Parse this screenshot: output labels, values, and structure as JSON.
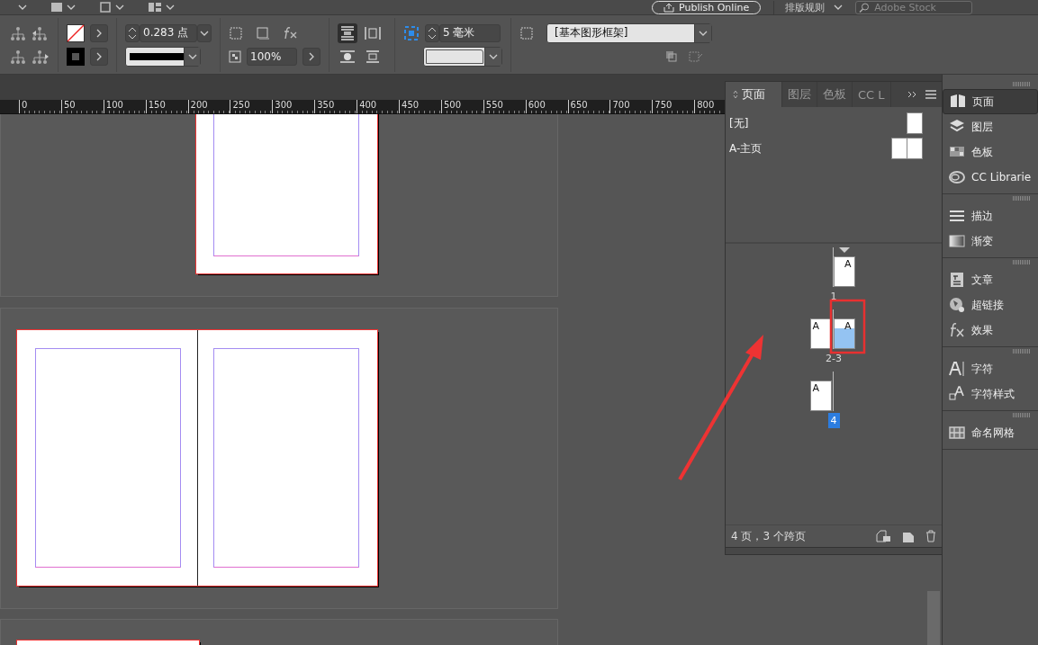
{
  "top_bar": {
    "publish_button": "Publish Online",
    "workspace_menu": "排版规则",
    "stock_search": {
      "placeholder": "Adobe Stock"
    }
  },
  "control_bar": {
    "stroke_weight": "0.283 点",
    "opacity": "100%",
    "gap": "5 毫米",
    "object_style": "[基本图形框架]",
    "wrap_options": [
      {
        "selected": true
      },
      {
        "selected": false
      },
      {
        "selected": false
      },
      {
        "selected": false
      }
    ]
  },
  "ruler": {
    "labels": [
      "0",
      "50",
      "100",
      "150",
      "200",
      "250",
      "300",
      "350",
      "400",
      "450",
      "500",
      "550",
      "600",
      "650",
      "700",
      "750",
      "800"
    ]
  },
  "pages_panel": {
    "tabs": [
      {
        "label": "页面",
        "selected": true
      },
      {
        "label": "图层",
        "selected": false
      },
      {
        "label": "色板",
        "selected": false
      },
      {
        "label": "CC L",
        "selected": false
      }
    ],
    "masters": [
      {
        "label": "[无]",
        "kind": "single"
      },
      {
        "label": "A-主页",
        "kind": "spread"
      }
    ],
    "spreads": [
      {
        "label": "1",
        "selected": false,
        "right_page": {
          "master": "A",
          "selected": false
        }
      },
      {
        "label": "2-3",
        "selected": false,
        "left_page": {
          "master": "A",
          "selected": false
        },
        "right_page": {
          "master": "A",
          "selected": true
        }
      },
      {
        "label": "4",
        "selected": true,
        "left_page": {
          "master": "A",
          "selected": false
        }
      }
    ],
    "status": "4 页，3 个跨页"
  },
  "dock": {
    "groups": [
      {
        "items": [
          {
            "label": "页面",
            "selected": true
          },
          {
            "label": "图层",
            "selected": false
          },
          {
            "label": "色板",
            "selected": false
          },
          {
            "label": "CC Librarie",
            "selected": false
          }
        ]
      },
      {
        "items": [
          {
            "label": "描边",
            "selected": false
          },
          {
            "label": "渐变",
            "selected": false
          }
        ]
      },
      {
        "items": [
          {
            "label": "文章",
            "selected": false
          },
          {
            "label": "超链接",
            "selected": false
          },
          {
            "label": "效果",
            "selected": false
          }
        ]
      },
      {
        "items": [
          {
            "label": "字符",
            "selected": false
          },
          {
            "label": "字符样式",
            "selected": false
          }
        ]
      },
      {
        "items": [
          {
            "label": "命名网格",
            "selected": false
          }
        ]
      }
    ]
  }
}
